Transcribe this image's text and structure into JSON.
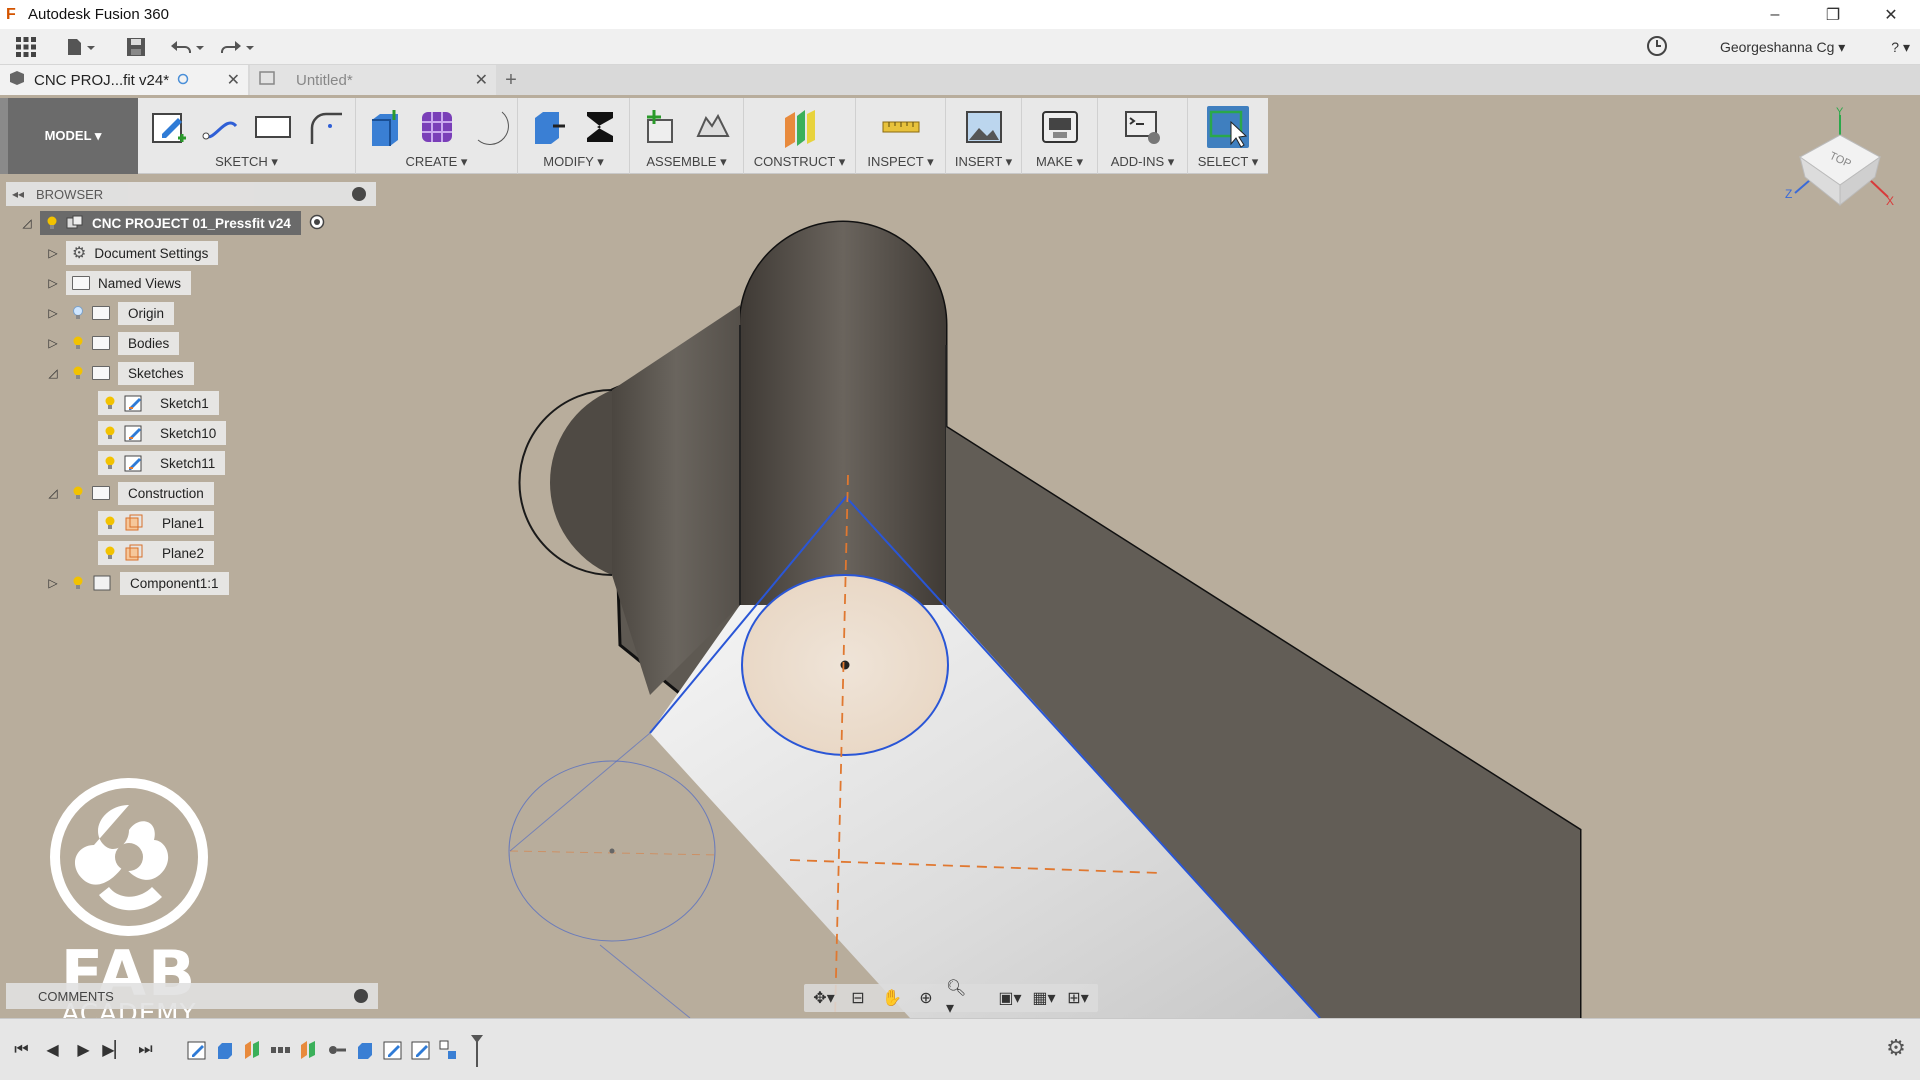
{
  "window": {
    "title": "Autodesk Fusion 360",
    "app_letter": "F",
    "minimize": "–",
    "restore": "❐",
    "close": "✕"
  },
  "quick_access": {
    "user": "Georgeshanna Cg ▾",
    "help": "? ▾"
  },
  "tabs": [
    {
      "label": "CNC PROJ...fit v24*",
      "active": true
    },
    {
      "label": "Untitled*",
      "active": false
    }
  ],
  "toolbar": {
    "workspace": "MODEL ▾",
    "groups": [
      {
        "label": "SKETCH ▾"
      },
      {
        "label": "CREATE ▾"
      },
      {
        "label": "MODIFY ▾"
      },
      {
        "label": "ASSEMBLE ▾"
      },
      {
        "label": "CONSTRUCT ▾"
      },
      {
        "label": "INSPECT ▾"
      },
      {
        "label": "INSERT ▾"
      },
      {
        "label": "MAKE ▾"
      },
      {
        "label": "ADD-INS ▾"
      },
      {
        "label": "SELECT ▾"
      }
    ]
  },
  "browser": {
    "title": "BROWSER",
    "root": "CNC PROJECT 01_Pressfit v24",
    "items": {
      "document_settings": "Document Settings",
      "named_views": "Named Views",
      "origin": "Origin",
      "bodies": "Bodies",
      "sketches": "Sketches",
      "sketch1": "Sketch1",
      "sketch10": "Sketch10",
      "sketch11": "Sketch11",
      "construction": "Construction",
      "plane1": "Plane1",
      "plane2": "Plane2",
      "component": "Component1:1"
    }
  },
  "comments": {
    "label": "COMMENTS"
  },
  "viewcube": {
    "face": "TOP",
    "axis_x": "X",
    "axis_y": "Y",
    "axis_z": "Z"
  },
  "watermark": {
    "fab": "FAB",
    "academy": "ACADEMY"
  },
  "colors": {
    "background": "#b8ad9c",
    "accent_select": "#3f7fbf",
    "bulb": "#f2c200",
    "sketch_blue": "#2a56d6",
    "axis_orange": "#e07830"
  }
}
